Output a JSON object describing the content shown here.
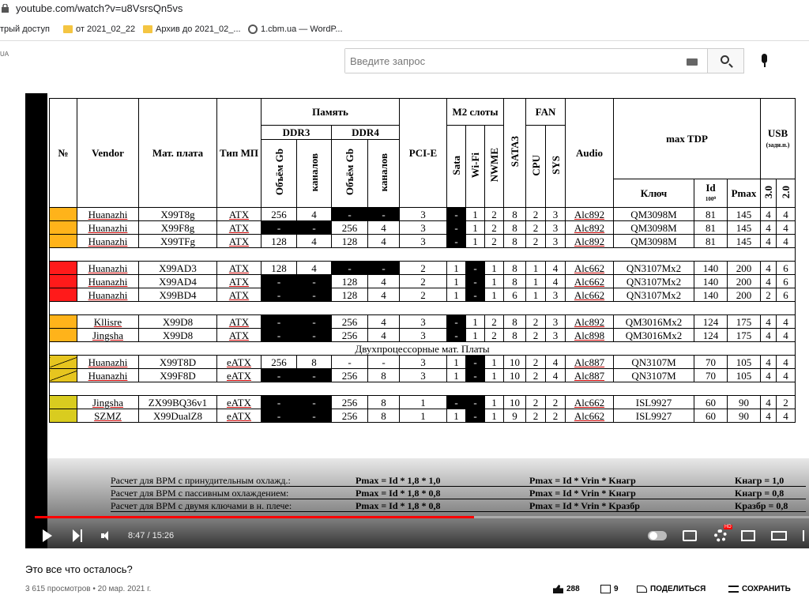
{
  "browser": {
    "url": "youtube.com/watch?v=u8VsrsQn5vs",
    "bookmarks": [
      {
        "label": "трый доступ",
        "icon": "none"
      },
      {
        "label": "от 2021_02_22",
        "icon": "folder-icon"
      },
      {
        "label": "Архив до 2021_02_...",
        "icon": "folder-icon"
      },
      {
        "label": "1.cbm.ua — WordP...",
        "icon": "globe-icon"
      }
    ]
  },
  "youtube": {
    "region": "UA",
    "search_placeholder": "Введите запрос"
  },
  "table": {
    "headers": {
      "num": "№",
      "vendor": "Vendor",
      "board": "Мат. плата",
      "type": "Тип МП",
      "memory": "Память",
      "ddr3": "DDR3",
      "ddr4": "DDR4",
      "volume": "Объём Gb",
      "channels": "каналов",
      "pcie": "PCI-E",
      "m2": "M2 слоты",
      "sata": "Sata",
      "wifi": "Wi-Fi",
      "nvme": "NWME",
      "sata3": "SATA3",
      "fan": "FAN",
      "cpu": "CPU",
      "sys": "SYS",
      "audio": "Audio",
      "maxtdp": "max TDP",
      "key": "Ключ",
      "id": "Id",
      "id_sub": "100⁰",
      "pmax": "Pmax",
      "usb": "USB",
      "usb_sub": "(задн.п.)",
      "usb3": "3.0",
      "usb2": "2.0"
    },
    "groups": [
      {
        "color": "orange",
        "rows": [
          {
            "vendor": "Huanazhi",
            "board": "X99T8g",
            "type": "ATX",
            "ddr3v": "256",
            "ddr3c": "4",
            "ddr4v": "-",
            "ddr4c": "-",
            "pcie": "3",
            "sata": "-",
            "wifi": "1",
            "nvme": "2",
            "sata3": "8",
            "cpu": "2",
            "sys": "3",
            "audio": "Alc892",
            "key": "QM3098M",
            "id": "81",
            "pmax": "145",
            "usb3": "4",
            "usb2": "4",
            "blk": [
              "ddr4v",
              "ddr4c",
              "sata"
            ]
          },
          {
            "vendor": "Huanazhi",
            "board": "X99F8g",
            "type": "ATX",
            "ddr3v": "-",
            "ddr3c": "-",
            "ddr4v": "256",
            "ddr4c": "4",
            "pcie": "3",
            "sata": "-",
            "wifi": "1",
            "nvme": "2",
            "sata3": "8",
            "cpu": "2",
            "sys": "3",
            "audio": "Alc892",
            "key": "QM3098M",
            "id": "81",
            "pmax": "145",
            "usb3": "4",
            "usb2": "4",
            "blk": [
              "ddr3v",
              "ddr3c",
              "sata"
            ]
          },
          {
            "vendor": "Huanazhi",
            "board": "X99TFg",
            "type": "ATX",
            "ddr3v": "128",
            "ddr3c": "4",
            "ddr4v": "128",
            "ddr4c": "4",
            "pcie": "3",
            "sata": "-",
            "wifi": "1",
            "nvme": "2",
            "sata3": "8",
            "cpu": "2",
            "sys": "3",
            "audio": "Alc892",
            "key": "QM3098M",
            "id": "81",
            "pmax": "145",
            "usb3": "4",
            "usb2": "4",
            "blk": [
              "sata"
            ]
          }
        ]
      },
      {
        "color": "red",
        "rows": [
          {
            "vendor": "Huanazhi",
            "board": "X99AD3",
            "type": "ATX",
            "ddr3v": "128",
            "ddr3c": "4",
            "ddr4v": "-",
            "ddr4c": "-",
            "pcie": "2",
            "sata": "1",
            "wifi": "-",
            "nvme": "1",
            "sata3": "8",
            "cpu": "1",
            "sys": "4",
            "audio": "Alc662",
            "key": "QN3107Mx2",
            "id": "140",
            "pmax": "200",
            "usb3": "4",
            "usb2": "6",
            "blk": [
              "ddr4v",
              "ddr4c",
              "wifi"
            ]
          },
          {
            "vendor": "Huanazhi",
            "board": "X99AD4",
            "type": "ATX",
            "ddr3v": "-",
            "ddr3c": "-",
            "ddr4v": "128",
            "ddr4c": "4",
            "pcie": "2",
            "sata": "1",
            "wifi": "-",
            "nvme": "1",
            "sata3": "8",
            "cpu": "1",
            "sys": "4",
            "audio": "Alc662",
            "key": "QN3107Mx2",
            "id": "140",
            "pmax": "200",
            "usb3": "4",
            "usb2": "6",
            "blk": [
              "ddr3v",
              "ddr3c",
              "wifi"
            ]
          },
          {
            "vendor": "Huanazhi",
            "board": "X99BD4",
            "type": "ATX",
            "ddr3v": "-",
            "ddr3c": "-",
            "ddr4v": "128",
            "ddr4c": "4",
            "pcie": "2",
            "sata": "1",
            "wifi": "-",
            "nvme": "1",
            "sata3": "6",
            "cpu": "1",
            "sys": "3",
            "audio": "Alc662",
            "key": "QN3107Mx2",
            "id": "140",
            "pmax": "200",
            "usb3": "2",
            "usb2": "6",
            "blk": [
              "ddr3v",
              "ddr3c",
              "wifi"
            ]
          }
        ]
      },
      {
        "color": "orange",
        "rows": [
          {
            "vendor": "Kllisre",
            "board": "X99D8",
            "type": "ATX",
            "ddr3v": "-",
            "ddr3c": "-",
            "ddr4v": "256",
            "ddr4c": "4",
            "pcie": "3",
            "sata": "-",
            "wifi": "1",
            "nvme": "2",
            "sata3": "8",
            "cpu": "2",
            "sys": "3",
            "audio": "Alc892",
            "key": "QM3016Mx2",
            "id": "124",
            "pmax": "175",
            "usb3": "4",
            "usb2": "4",
            "blk": [
              "ddr3v",
              "ddr3c",
              "sata"
            ]
          },
          {
            "vendor": "Jingsha",
            "board": "X99D8",
            "type": "ATX",
            "ddr3v": "-",
            "ddr3c": "-",
            "ddr4v": "256",
            "ddr4c": "4",
            "pcie": "3",
            "sata": "-",
            "wifi": "1",
            "nvme": "2",
            "sata3": "8",
            "cpu": "2",
            "sys": "3",
            "audio": "Alc898",
            "key": "QM3016Mx2",
            "id": "124",
            "pmax": "175",
            "usb3": "4",
            "usb2": "4",
            "blk": [
              "ddr3v",
              "ddr3c",
              "sata"
            ]
          }
        ]
      },
      {
        "section_title": "Двухпроцессорные мат. Платы",
        "color": "olive",
        "rows": [
          {
            "vendor": "Huanazhi",
            "board": "X99T8D",
            "type": "eATX",
            "ddr3v": "256",
            "ddr3c": "8",
            "ddr4v": "-",
            "ddr4c": "-",
            "pcie": "3",
            "sata": "1",
            "wifi": "-",
            "nvme": "1",
            "sata3": "10",
            "cpu": "2",
            "sys": "4",
            "audio": "Alc887",
            "key": "QN3107M",
            "id": "70",
            "pmax": "105",
            "usb3": "4",
            "usb2": "4",
            "blk": [
              "wifi"
            ]
          },
          {
            "vendor": "Huanazhi",
            "board": "X99F8D",
            "type": "eATX",
            "ddr3v": "-",
            "ddr3c": "-",
            "ddr4v": "256",
            "ddr4c": "8",
            "pcie": "3",
            "sata": "1",
            "wifi": "-",
            "nvme": "1",
            "sata3": "10",
            "cpu": "2",
            "sys": "4",
            "audio": "Alc887",
            "key": "QN3107M",
            "id": "70",
            "pmax": "105",
            "usb3": "4",
            "usb2": "4",
            "blk": [
              "ddr3v",
              "ddr3c",
              "wifi"
            ]
          }
        ]
      },
      {
        "color": "yellow",
        "rows": [
          {
            "vendor": "Jingsha",
            "board": "ZX99BQ36v1",
            "type": "eATX",
            "ddr3v": "-",
            "ddr3c": "-",
            "ddr4v": "256",
            "ddr4c": "8",
            "pcie": "1",
            "sata": "-",
            "wifi": "-",
            "nvme": "1",
            "sata3": "10",
            "cpu": "2",
            "sys": "2",
            "audio": "Alc662",
            "key": "ISL9927",
            "id": "60",
            "pmax": "90",
            "usb3": "4",
            "usb2": "2",
            "blk": [
              "ddr3v",
              "ddr3c",
              "sata",
              "wifi"
            ]
          },
          {
            "vendor": "SZMZ",
            "board": "X99DualZ8",
            "type": "eATX",
            "ddr3v": "-",
            "ddr3c": "-",
            "ddr4v": "256",
            "ddr4c": "8",
            "pcie": "1",
            "sata": "1",
            "wifi": "-",
            "nvme": "1",
            "sata3": "9",
            "cpu": "2",
            "sys": "2",
            "audio": "Alc662",
            "key": "ISL9927",
            "id": "60",
            "pmax": "90",
            "usb3": "4",
            "usb2": "4",
            "blk": [
              "ddr3v",
              "ddr3c",
              "wifi"
            ]
          }
        ]
      }
    ]
  },
  "calc": [
    {
      "label": "Расчет для BPM с принудительным охлажд.:",
      "formula1": "Pmax = Id * 1,8 * 1,0",
      "formula2": "Pmax = Id * Vrin * Kнагр",
      "coef": "Kнагр = 1,0"
    },
    {
      "label": "Расчет для BPM с пассивным охлаждением:",
      "formula1": "Pmax = Id * 1,8 * 0,8",
      "formula2": "Pmax = Id * Vrin * Kнагр",
      "coef": "Kнагр = 0,8"
    },
    {
      "label": "Расчет для BPM с двумя ключами в н. плече:",
      "formula1": "Pmax = Id * 1,8 * 0,8",
      "formula2": "Pmax = Id * Vrin * Kразбр",
      "coef": "Kразбр = 0,8"
    }
  ],
  "player": {
    "time": "8:47 / 15:26",
    "progress_fraction": 0.5676,
    "hd_badge": "HD"
  },
  "video": {
    "title": "Это все что осталось?",
    "meta": "3 615 просмотров • 20 мар. 2021 г.",
    "likes": "288",
    "dislikes": "9",
    "share": "ПОДЕЛИТЬСЯ",
    "save": "СОХРАНИТЬ"
  },
  "colors": {
    "orange": "#ffb31a",
    "red": "#ff1a1a",
    "yellow": "#d9cc1f",
    "olive": "#e6c51f",
    "progress": "#ff0000"
  }
}
